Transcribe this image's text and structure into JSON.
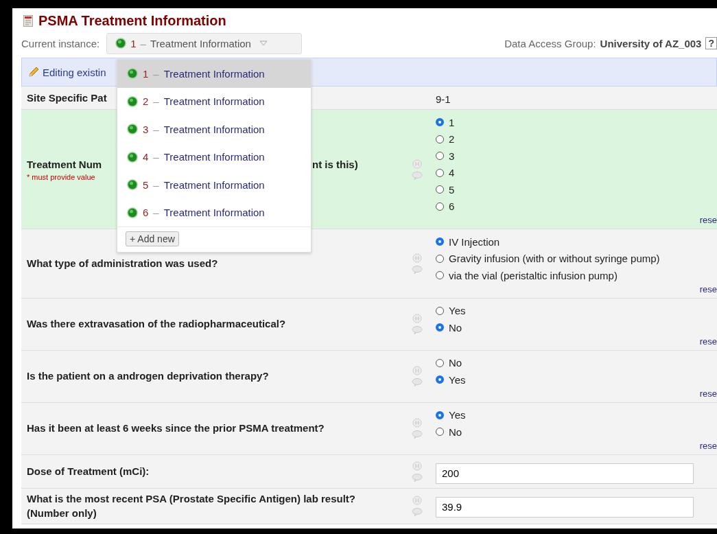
{
  "form": {
    "title": "PSMA Treatment Information"
  },
  "instance": {
    "label": "Current instance:",
    "current": {
      "number": "1",
      "separator": "–",
      "label": "Treatment Information"
    }
  },
  "data_access_group": {
    "label": "Data Access Group:",
    "value": "University of AZ_003",
    "help": "?"
  },
  "editing_banner": {
    "text": "Editing existin"
  },
  "instance_menu": {
    "items": [
      {
        "number": "1",
        "separator": "–",
        "label": "Treatment Information",
        "selected": true
      },
      {
        "number": "2",
        "separator": "–",
        "label": "Treatment Information",
        "selected": false
      },
      {
        "number": "3",
        "separator": "–",
        "label": "Treatment Information",
        "selected": false
      },
      {
        "number": "4",
        "separator": "–",
        "label": "Treatment Information",
        "selected": false
      },
      {
        "number": "5",
        "separator": "–",
        "label": "Treatment Information",
        "selected": false
      },
      {
        "number": "6",
        "separator": "–",
        "label": "Treatment Information",
        "selected": false
      }
    ],
    "add_button": "+ Add new"
  },
  "fields": [
    {
      "kind": "text",
      "label": "Site Specific Pat",
      "value": "9-1"
    },
    {
      "kind": "radio",
      "label": "Treatment Num",
      "label_end": "nt is this)",
      "required_note": "* must provide value",
      "reset": "rese",
      "options": [
        {
          "label": "1",
          "selected": true
        },
        {
          "label": "2",
          "selected": false
        },
        {
          "label": "3",
          "selected": false
        },
        {
          "label": "4",
          "selected": false
        },
        {
          "label": "5",
          "selected": false
        },
        {
          "label": "6",
          "selected": false
        }
      ]
    },
    {
      "kind": "radio",
      "label": "What type of administration was used?",
      "reset": "rese",
      "options": [
        {
          "label": "IV Injection",
          "selected": true
        },
        {
          "label": "Gravity infusion (with or without syringe pump)",
          "selected": false
        },
        {
          "label": "via the vial (peristaltic infusion pump)",
          "selected": false
        }
      ]
    },
    {
      "kind": "radio",
      "label": "Was there extravasation of the radiopharmaceutical?",
      "reset": "rese",
      "options": [
        {
          "label": "Yes",
          "selected": false
        },
        {
          "label": "No",
          "selected": true
        }
      ]
    },
    {
      "kind": "radio",
      "label": "Is the patient on a androgen deprivation therapy?",
      "reset": "rese",
      "options": [
        {
          "label": "No",
          "selected": false
        },
        {
          "label": "Yes",
          "selected": true
        }
      ]
    },
    {
      "kind": "radio",
      "label": "Has it been at least 6 weeks since the prior PSMA treatment?",
      "reset": "rese",
      "options": [
        {
          "label": "Yes",
          "selected": true
        },
        {
          "label": "No",
          "selected": false
        }
      ]
    },
    {
      "kind": "input",
      "label": "Dose of Treatment (mCi):",
      "value": "200"
    },
    {
      "kind": "input",
      "label": "What is the most recent PSA (Prostate Specific Antigen) lab result? (Number only)",
      "value": "39.9"
    }
  ]
}
